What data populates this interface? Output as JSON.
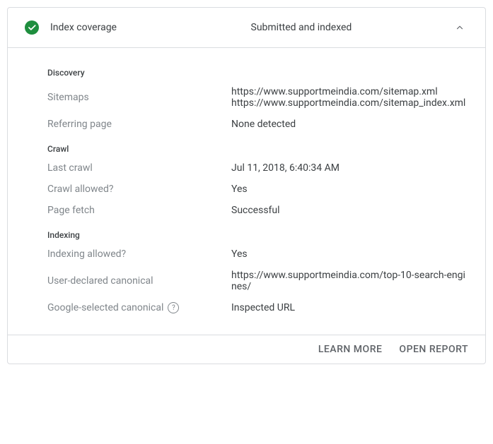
{
  "header": {
    "title": "Index coverage",
    "status": "Submitted and indexed"
  },
  "sections": {
    "discovery": {
      "heading": "Discovery",
      "sitemaps": {
        "label": "Sitemaps",
        "value1": "https://www.supportmeindia.com/sitemap.xml",
        "value2": "https://www.supportmeindia.com/sitemap_index.xml"
      },
      "referring": {
        "label": "Referring page",
        "value": "None detected"
      }
    },
    "crawl": {
      "heading": "Crawl",
      "lastCrawl": {
        "label": "Last crawl",
        "value": "Jul 11, 2018, 6:40:34 AM"
      },
      "crawlAllowed": {
        "label": "Crawl allowed?",
        "value": "Yes"
      },
      "pageFetch": {
        "label": "Page fetch",
        "value": "Successful"
      }
    },
    "indexing": {
      "heading": "Indexing",
      "indexingAllowed": {
        "label": "Indexing allowed?",
        "value": "Yes"
      },
      "userCanonical": {
        "label": "User-declared canonical",
        "value": "https://www.supportmeindia.com/top-10-search-engines/"
      },
      "googleCanonical": {
        "label": "Google-selected canonical",
        "value": "Inspected URL"
      }
    }
  },
  "footer": {
    "learnMore": "LEARN MORE",
    "openReport": "OPEN REPORT"
  }
}
